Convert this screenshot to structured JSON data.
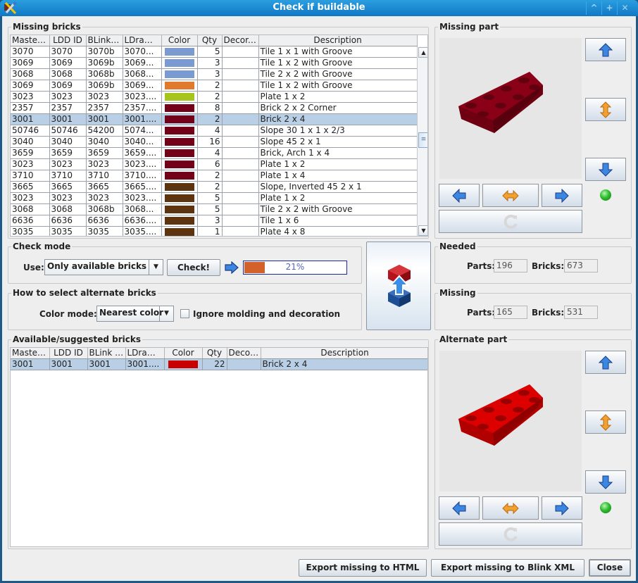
{
  "window": {
    "title": "Check if buildable",
    "controls": [
      "minimize",
      "maximize",
      "close"
    ]
  },
  "missing_bricks": {
    "title": "Missing bricks",
    "columns": [
      "Master...",
      "LDD ID",
      "BLink ID",
      "LDraw ID",
      "Color",
      "Qty",
      "Decor....",
      "Description"
    ],
    "rows": [
      {
        "master": "3070",
        "ldd": "3070",
        "blink": "3070b",
        "ldraw": "3070...",
        "color": "#7b9bd0",
        "qty": "5",
        "decor": "",
        "desc": "Tile 1 x 1 with Groove"
      },
      {
        "master": "3069",
        "ldd": "3069",
        "blink": "3069b",
        "ldraw": "3069...",
        "color": "#7b9bd0",
        "qty": "3",
        "decor": "",
        "desc": "Tile 1 x 2 with Groove"
      },
      {
        "master": "3068",
        "ldd": "3068",
        "blink": "3068b",
        "ldraw": "3068...",
        "color": "#7b9bd0",
        "qty": "3",
        "decor": "",
        "desc": "Tile 2 x 2 with Groove"
      },
      {
        "master": "3069",
        "ldd": "3069",
        "blink": "3069b",
        "ldraw": "3069...",
        "color": "#e07a2c",
        "qty": "2",
        "decor": "",
        "desc": "Tile 1 x 2 with Groove"
      },
      {
        "master": "3023",
        "ldd": "3023",
        "blink": "3023",
        "ldraw": "3023....",
        "color": "#a5c51c",
        "qty": "2",
        "decor": "",
        "desc": "Plate 1 x 2"
      },
      {
        "master": "2357",
        "ldd": "2357",
        "blink": "2357",
        "ldraw": "2357....",
        "color": "#720018",
        "qty": "8",
        "decor": "",
        "desc": "Brick 2 x 2 Corner"
      },
      {
        "master": "3001",
        "ldd": "3001",
        "blink": "3001",
        "ldraw": "3001....",
        "color": "#720018",
        "qty": "2",
        "decor": "",
        "desc": "Brick 2 x 4",
        "selected": true
      },
      {
        "master": "50746",
        "ldd": "50746",
        "blink": "54200",
        "ldraw": "5074...",
        "color": "#720018",
        "qty": "4",
        "decor": "",
        "desc": "Slope 30 1 x 1 x 2/3"
      },
      {
        "master": "3040",
        "ldd": "3040",
        "blink": "3040",
        "ldraw": "3040...",
        "color": "#720018",
        "qty": "16",
        "decor": "",
        "desc": "Slope 45 2 x 1"
      },
      {
        "master": "3659",
        "ldd": "3659",
        "blink": "3659",
        "ldraw": "3659....",
        "color": "#720018",
        "qty": "4",
        "decor": "",
        "desc": "Brick, Arch 1 x 4"
      },
      {
        "master": "3023",
        "ldd": "3023",
        "blink": "3023",
        "ldraw": "3023....",
        "color": "#720018",
        "qty": "6",
        "decor": "",
        "desc": "Plate 1 x 2"
      },
      {
        "master": "3710",
        "ldd": "3710",
        "blink": "3710",
        "ldraw": "3710....",
        "color": "#720018",
        "qty": "2",
        "decor": "",
        "desc": "Plate 1 x 4"
      },
      {
        "master": "3665",
        "ldd": "3665",
        "blink": "3665",
        "ldraw": "3665....",
        "color": "#5c3410",
        "qty": "2",
        "decor": "",
        "desc": "Slope, Inverted 45 2 x 1"
      },
      {
        "master": "3023",
        "ldd": "3023",
        "blink": "3023",
        "ldraw": "3023....",
        "color": "#5c3410",
        "qty": "5",
        "decor": "",
        "desc": "Plate 1 x 2"
      },
      {
        "master": "3068",
        "ldd": "3068",
        "blink": "3068b",
        "ldraw": "3068...",
        "color": "#5c3410",
        "qty": "5",
        "decor": "",
        "desc": "Tile 2 x 2 with Groove"
      },
      {
        "master": "6636",
        "ldd": "6636",
        "blink": "6636",
        "ldraw": "6636....",
        "color": "#5c3410",
        "qty": "3",
        "decor": "",
        "desc": "Tile 1 x 6"
      },
      {
        "master": "3035",
        "ldd": "3035",
        "blink": "3035",
        "ldraw": "3035....",
        "color": "#5c3410",
        "qty": "1",
        "decor": "",
        "desc": "Plate 4 x 8"
      }
    ]
  },
  "check_mode": {
    "title": "Check mode",
    "use_label": "Use:",
    "use_value": "Only available bricks",
    "check_button": "Check!",
    "progress_percent": 21,
    "progress_text": "21%"
  },
  "alternate_select": {
    "title": "How to select alternate bricks",
    "color_mode_label": "Color mode:",
    "color_mode_value": "Nearest color",
    "ignore_label": "Ignore molding and decoration",
    "ignore_checked": false
  },
  "available_bricks": {
    "title": "Available/suggested bricks",
    "columns": [
      "Master...",
      "LDD ID",
      "BLink ID",
      "LDraw ID",
      "Color",
      "Qty",
      "Decor. ID",
      "Description"
    ],
    "rows": [
      {
        "master": "3001",
        "ldd": "3001",
        "blink": "3001",
        "ldraw": "3001....",
        "color": "#c80000",
        "qty": "22",
        "decor": "",
        "desc": "Brick 2 x 4",
        "selected": true
      }
    ]
  },
  "missing_part": {
    "title": "Missing part",
    "brick_color": "#8a0016"
  },
  "alternate_part": {
    "title": "Alternate part",
    "brick_color": "#dd0000"
  },
  "needed": {
    "title": "Needed",
    "parts_label": "Parts:",
    "parts_value": "196",
    "bricks_label": "Bricks:",
    "bricks_value": "673"
  },
  "missing": {
    "title": "Missing",
    "parts_label": "Parts:",
    "parts_value": "165",
    "bricks_label": "Bricks:",
    "bricks_value": "531"
  },
  "footer": {
    "export_html": "Export missing to HTML",
    "export_blink": "Export missing to Blink XML",
    "close": "Close"
  }
}
